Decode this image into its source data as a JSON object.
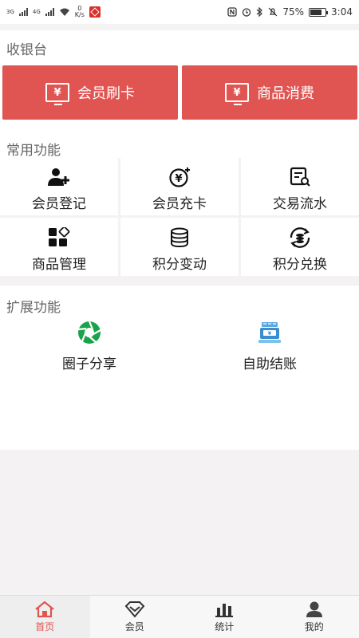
{
  "status_bar": {
    "net1": "3G",
    "net2": "4G",
    "speed_value": "0",
    "speed_unit": "K/s",
    "battery": "75%",
    "time": "3:04"
  },
  "cashier": {
    "title": "收银台",
    "buttons": [
      {
        "label": "会员刷卡",
        "icon": "yen-card-icon"
      },
      {
        "label": "商品消费",
        "icon": "yen-pay-icon"
      }
    ],
    "accent": "#e05452"
  },
  "common": {
    "title": "常用功能",
    "items": [
      {
        "label": "会员登记",
        "icon": "add-user-icon"
      },
      {
        "label": "会员充卡",
        "icon": "yen-recharge-icon"
      },
      {
        "label": "交易流水",
        "icon": "transaction-search-icon"
      },
      {
        "label": "商品管理",
        "icon": "apps-grid-icon"
      },
      {
        "label": "积分变动",
        "icon": "coin-stack-icon"
      },
      {
        "label": "积分兑换",
        "icon": "coin-exchange-icon"
      }
    ]
  },
  "extension": {
    "title": "扩展功能",
    "items": [
      {
        "label": "圈子分享",
        "icon": "aperture-icon",
        "color": "#1aa34a"
      },
      {
        "label": "自助结账",
        "icon": "self-checkout-icon",
        "color": "#3a8ed0"
      }
    ]
  },
  "bottom_nav": {
    "tabs": [
      {
        "label": "首页",
        "icon": "home-icon",
        "active": true
      },
      {
        "label": "会员",
        "icon": "diamond-icon",
        "active": false
      },
      {
        "label": "统计",
        "icon": "bar-chart-icon",
        "active": false
      },
      {
        "label": "我的",
        "icon": "person-icon",
        "active": false
      }
    ]
  }
}
